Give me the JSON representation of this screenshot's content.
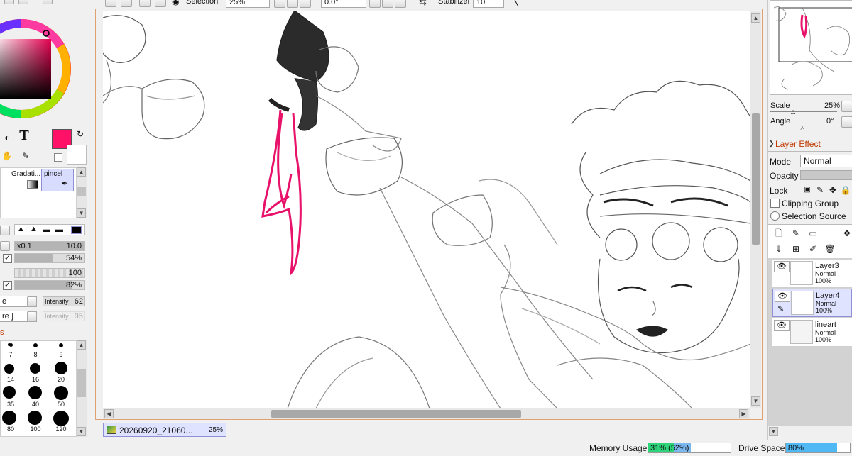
{
  "toolbar": {
    "selection_label": "Selection",
    "zoom_value": "25%",
    "angle_value": "0.0°",
    "stabilizer_label": "Stabilizer",
    "stabilizer_value": "10"
  },
  "colors": {
    "foreground": "#ff1167",
    "background": "#ffffff",
    "accent_pink": "#e8126a"
  },
  "tools": {
    "gradation_label": "Gradati...",
    "pincel_label": "pincel"
  },
  "brush": {
    "size_mult": "x0.1",
    "size_value": "10.0",
    "density_value": "54%",
    "texture_value": "100",
    "blending_value": "82%",
    "intensity_label": "Intensity",
    "intensity_value": "62",
    "intensity2_label": "Intensity",
    "intensity2_value": "95",
    "dropdown1": "e",
    "dropdown2": "re ]",
    "section_label": "s"
  },
  "brush_sizes": {
    "labels": [
      "7",
      "8",
      "9",
      "14",
      "16",
      "20",
      "35",
      "40",
      "50",
      "80",
      "100",
      "120"
    ]
  },
  "document": {
    "tab_name": "20260920_21060...",
    "tab_zoom": "25%"
  },
  "navigator": {
    "scale_label": "Scale",
    "scale_value": "25%",
    "angle_label": "Angle",
    "angle_value": "0°"
  },
  "layer_panel": {
    "effect_header": "Layer Effect",
    "mode_label": "Mode",
    "mode_value": "Normal",
    "opacity_label": "Opacity",
    "lock_label": "Lock",
    "clipping_label": "Clipping Group",
    "selection_source_label": "Selection Source",
    "layers": [
      {
        "name": "Layer3",
        "mode": "Normal",
        "opacity": "100%"
      },
      {
        "name": "Layer4",
        "mode": "Normal",
        "opacity": "100%"
      },
      {
        "name": "lineart",
        "mode": "Normal",
        "opacity": "100%"
      }
    ]
  },
  "status": {
    "memory_label": "Memory Usage",
    "memory_value": "31% (52%)",
    "memory_fraction": 0.31,
    "drive_label": "Drive Space",
    "drive_value": "80%",
    "drive_fraction": 0.8
  }
}
